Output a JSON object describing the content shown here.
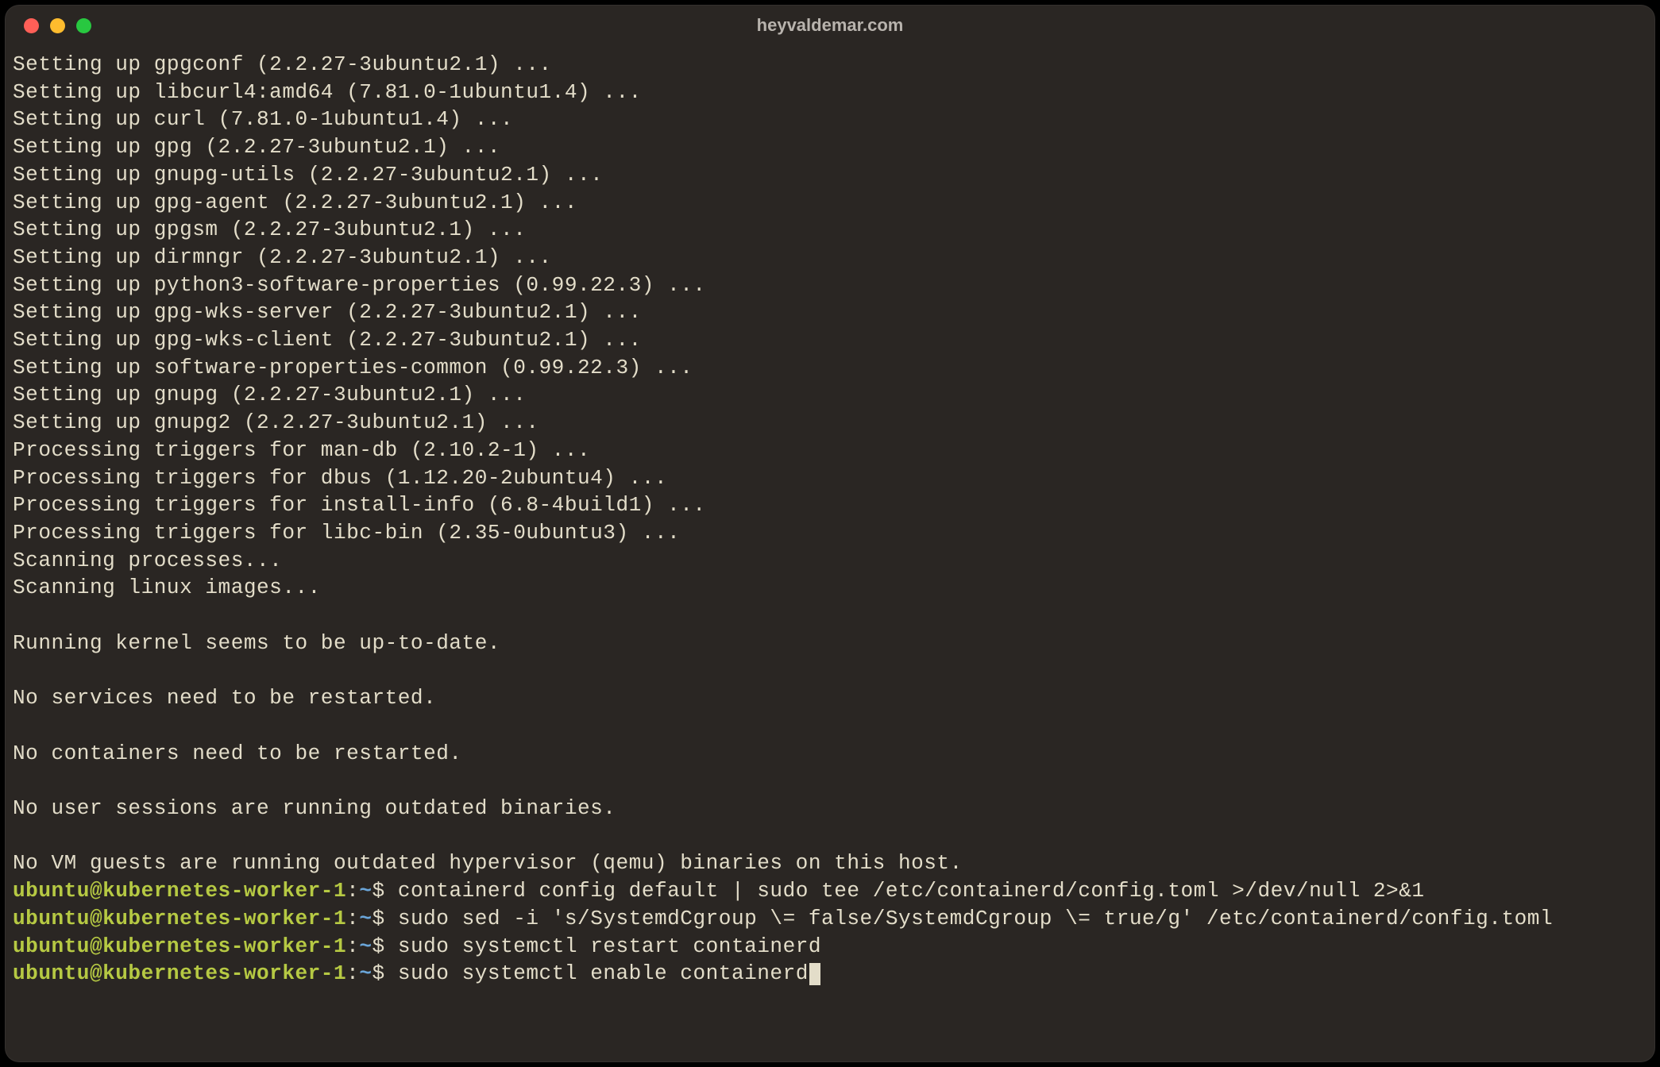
{
  "title": "heyvaldemar.com",
  "colors": {
    "bg": "#2a2623",
    "text": "#e3ddc9",
    "promptUser": "#b6c943",
    "promptPath": "#6aa5d8"
  },
  "output_lines": [
    "Setting up gpgconf (2.2.27-3ubuntu2.1) ...",
    "Setting up libcurl4:amd64 (7.81.0-1ubuntu1.4) ...",
    "Setting up curl (7.81.0-1ubuntu1.4) ...",
    "Setting up gpg (2.2.27-3ubuntu2.1) ...",
    "Setting up gnupg-utils (2.2.27-3ubuntu2.1) ...",
    "Setting up gpg-agent (2.2.27-3ubuntu2.1) ...",
    "Setting up gpgsm (2.2.27-3ubuntu2.1) ...",
    "Setting up dirmngr (2.2.27-3ubuntu2.1) ...",
    "Setting up python3-software-properties (0.99.22.3) ...",
    "Setting up gpg-wks-server (2.2.27-3ubuntu2.1) ...",
    "Setting up gpg-wks-client (2.2.27-3ubuntu2.1) ...",
    "Setting up software-properties-common (0.99.22.3) ...",
    "Setting up gnupg (2.2.27-3ubuntu2.1) ...",
    "Setting up gnupg2 (2.2.27-3ubuntu2.1) ...",
    "Processing triggers for man-db (2.10.2-1) ...",
    "Processing triggers for dbus (1.12.20-2ubuntu4) ...",
    "Processing triggers for install-info (6.8-4build1) ...",
    "Processing triggers for libc-bin (2.35-0ubuntu3) ...",
    "Scanning processes...",
    "Scanning linux images...",
    "",
    "Running kernel seems to be up-to-date.",
    "",
    "No services need to be restarted.",
    "",
    "No containers need to be restarted.",
    "",
    "No user sessions are running outdated binaries.",
    "",
    "No VM guests are running outdated hypervisor (qemu) binaries on this host."
  ],
  "prompt": {
    "user_host": "ubuntu@kubernetes-worker-1",
    "sep": ":",
    "path": "~",
    "symbol": "$"
  },
  "commands": [
    "containerd config default | sudo tee /etc/containerd/config.toml >/dev/null 2>&1",
    "sudo sed -i 's/SystemdCgroup \\= false/SystemdCgroup \\= true/g' /etc/containerd/config.toml",
    "sudo systemctl restart containerd",
    "sudo systemctl enable containerd"
  ]
}
